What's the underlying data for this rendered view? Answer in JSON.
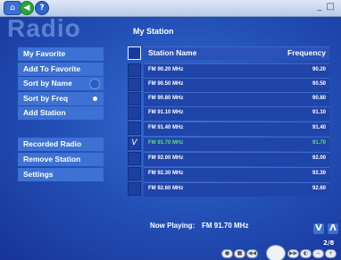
{
  "app": {
    "title": "Radio",
    "section_title": "My Station"
  },
  "topbar": {
    "home_icon": "home-icon",
    "back_icon": "back-icon",
    "help_glyph": "?",
    "window_controls": "_ □"
  },
  "menu": {
    "top": [
      {
        "label": "My Favorite"
      },
      {
        "label": "Add To Favorite"
      },
      {
        "label": "Sort by Name"
      },
      {
        "label": "Sort by Freq",
        "selected": true
      },
      {
        "label": "Add Station"
      }
    ],
    "bottom": [
      {
        "label": "Recorded Radio"
      },
      {
        "label": "Remove Station"
      },
      {
        "label": "Settings"
      }
    ]
  },
  "table": {
    "col_name": "Station Name",
    "col_freq": "Frequency",
    "rows": [
      {
        "name": "FM 90.20 MHz",
        "freq": "90.20",
        "checked": "",
        "selected": false
      },
      {
        "name": "FM 90.50 MHz",
        "freq": "90.50",
        "checked": "",
        "selected": false
      },
      {
        "name": "FM 90.80 MHz",
        "freq": "90.80",
        "checked": "",
        "selected": false
      },
      {
        "name": "FM 91.10 MHz",
        "freq": "91.10",
        "checked": "",
        "selected": false
      },
      {
        "name": "FM 91.40 MHz",
        "freq": "91.40",
        "checked": "",
        "selected": false
      },
      {
        "name": "FM 91.70 MHz",
        "freq": "91.70",
        "checked": "V",
        "selected": true
      },
      {
        "name": "FM 92.00 MHz",
        "freq": "92.00",
        "checked": "",
        "selected": false
      },
      {
        "name": "FM 92.30 MHz",
        "freq": "92.30",
        "checked": "",
        "selected": false
      },
      {
        "name": "FM 92.60 MHz",
        "freq": "92.60",
        "checked": "",
        "selected": false
      }
    ]
  },
  "pager": {
    "down_glyph": "V",
    "up_glyph": "Λ",
    "count": "2/8"
  },
  "now_playing": {
    "label": "Now Playing:",
    "value": "FM 91.70 MHz"
  },
  "colors": {
    "accent": "#3d71d3",
    "selected_text": "#58e070",
    "background": "#2452b8"
  }
}
